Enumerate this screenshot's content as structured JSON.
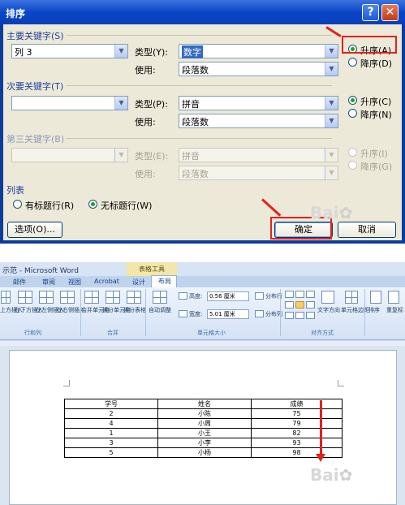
{
  "dialog": {
    "title": "排序",
    "help": "?",
    "close": "✕",
    "key1": {
      "label": "主要关键字(S)",
      "column": "列 3",
      "type_label": "类型(Y):",
      "type_value": "数字",
      "use_label": "使用:",
      "use_value": "段落数",
      "asc": "升序(A)",
      "desc": "降序(D)"
    },
    "key2": {
      "label": "次要关键字(T)",
      "column": "",
      "type_label": "类型(P):",
      "type_value": "拼音",
      "use_label": "使用:",
      "use_value": "段落数",
      "asc": "升序(C)",
      "desc": "降序(N)"
    },
    "key3": {
      "label": "第三关键字(B)",
      "column": "",
      "type_label": "类型(E):",
      "type_value": "拼音",
      "use_label": "使用:",
      "use_value": "段落数",
      "asc": "升序(I)",
      "desc": "降序(G)"
    },
    "list": {
      "label": "列表",
      "header_row": "有标题行(R)",
      "no_header_row": "无标题行(W)"
    },
    "options_button": "选项(O)...",
    "ok_button": "确定",
    "cancel_button": "取消"
  },
  "word": {
    "title": "示范 - Microsoft Word",
    "tool_group": "表格工具",
    "tabs": [
      "邮件",
      "审阅",
      "视图",
      "Acrobat",
      "设计",
      "布局"
    ],
    "ribbon": {
      "insert_above": "上方插入",
      "insert_below": "在下方插入",
      "insert_left": "在左侧插入",
      "insert_right": "在右侧插入",
      "merge_cells": "合并单元格",
      "split_cells": "拆分单元格",
      "split_table": "拆分表格",
      "autofit": "自动调整",
      "height_label": "高度:",
      "height_value": "0.56 厘米",
      "width_label": "宽度:",
      "width_value": "5.01 厘米",
      "distribute_rows": "分布行",
      "distribute_cols": "分布列",
      "text_direction": "文字方向",
      "cell_margins": "单元格边距",
      "sort": "排序",
      "repeat": "重复标",
      "group_rows_cols": "行和列",
      "group_merge": "合并",
      "group_cell_size": "单元格大小",
      "group_align": "对齐方式"
    },
    "table": {
      "headers": [
        "学号",
        "姓名",
        "成绩"
      ],
      "rows": [
        [
          "2",
          "小陈",
          "75"
        ],
        [
          "4",
          "小周",
          "79"
        ],
        [
          "1",
          "小王",
          "82"
        ],
        [
          "3",
          "小李",
          "93"
        ],
        [
          "5",
          "小杨",
          "98"
        ]
      ]
    }
  },
  "colors": {
    "annotation_red": "#e3211c",
    "xp_titlebar": "#0a46c8",
    "dialog_bg": "#ece9d8"
  }
}
